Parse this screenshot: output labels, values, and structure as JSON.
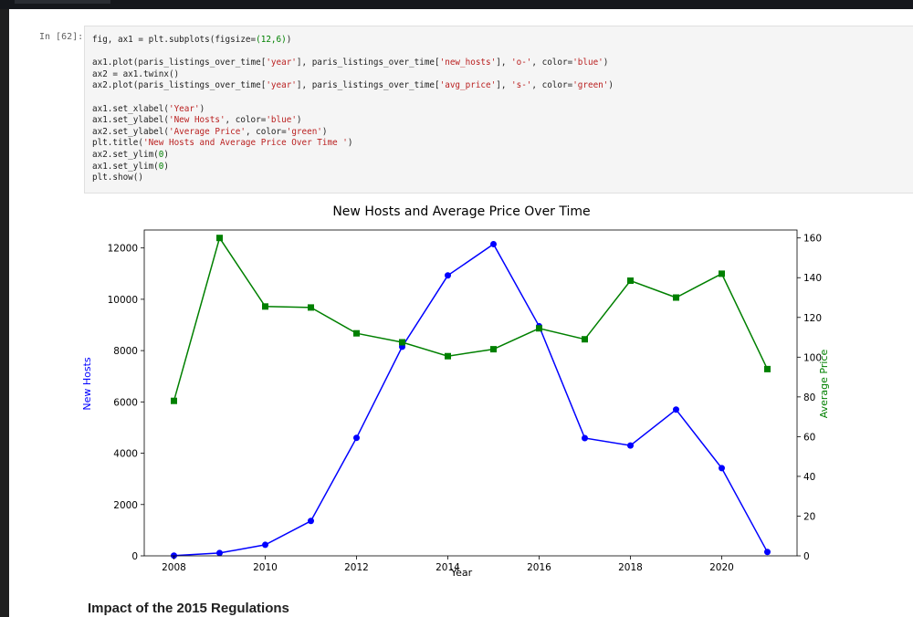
{
  "cell": {
    "prompt": "In [62]:",
    "code_lines": [
      [
        [
          "fig, ax1 = plt.subplots(figsize=",
          ""
        ],
        [
          "(12,6)",
          "n"
        ],
        [
          ")",
          ""
        ]
      ],
      [],
      [
        [
          "ax1.plot(paris_listings_over_time[",
          ""
        ],
        [
          "'year'",
          "s"
        ],
        [
          "], paris_listings_over_time[",
          ""
        ],
        [
          "'new_hosts'",
          "s"
        ],
        [
          "], ",
          ""
        ],
        [
          "'o-'",
          "s"
        ],
        [
          ", color=",
          ""
        ],
        [
          "'blue'",
          "s"
        ],
        [
          ")",
          ""
        ]
      ],
      [
        [
          "ax2 = ax1.twinx()",
          ""
        ]
      ],
      [
        [
          "ax2.plot(paris_listings_over_time[",
          ""
        ],
        [
          "'year'",
          "s"
        ],
        [
          "], paris_listings_over_time[",
          ""
        ],
        [
          "'avg_price'",
          "s"
        ],
        [
          "], ",
          ""
        ],
        [
          "'s-'",
          "s"
        ],
        [
          ", color=",
          ""
        ],
        [
          "'green'",
          "s"
        ],
        [
          ")",
          ""
        ]
      ],
      [],
      [
        [
          "ax1.set_xlabel(",
          ""
        ],
        [
          "'Year'",
          "s"
        ],
        [
          ")",
          ""
        ]
      ],
      [
        [
          "ax1.set_ylabel(",
          ""
        ],
        [
          "'New Hosts'",
          "s"
        ],
        [
          ", color=",
          ""
        ],
        [
          "'blue'",
          "s"
        ],
        [
          ")",
          ""
        ]
      ],
      [
        [
          "ax2.set_ylabel(",
          ""
        ],
        [
          "'Average Price'",
          "s"
        ],
        [
          ", color=",
          ""
        ],
        [
          "'green'",
          "s"
        ],
        [
          ")",
          ""
        ]
      ],
      [
        [
          "plt.title(",
          ""
        ],
        [
          "'New Hosts and Average Price Over Time '",
          "s"
        ],
        [
          ")",
          ""
        ]
      ],
      [
        [
          "ax2.set_ylim(",
          ""
        ],
        [
          "0",
          "n"
        ],
        [
          ")",
          ""
        ]
      ],
      [
        [
          "ax1.set_ylim(",
          ""
        ],
        [
          "0",
          "n"
        ],
        [
          ")",
          ""
        ]
      ],
      [
        [
          "plt.show()",
          ""
        ]
      ]
    ]
  },
  "chart_data": {
    "type": "line",
    "title": "New Hosts and Average Price Over Time",
    "xlabel": "Year",
    "ylabel_left": "New Hosts",
    "ylabel_right": "Average Price",
    "x": [
      2008,
      2009,
      2010,
      2011,
      2012,
      2013,
      2014,
      2015,
      2016,
      2017,
      2018,
      2019,
      2020,
      2021
    ],
    "xlim": [
      2007.35,
      2021.65
    ],
    "xticks": [
      2008,
      2010,
      2012,
      2014,
      2016,
      2018,
      2020
    ],
    "ylim_left": [
      0,
      12700
    ],
    "yticks_left": [
      0,
      2000,
      4000,
      6000,
      8000,
      10000,
      12000
    ],
    "ylim_right": [
      0,
      164
    ],
    "yticks_right": [
      0,
      20,
      40,
      60,
      80,
      100,
      120,
      140,
      160
    ],
    "grid": false,
    "series": [
      {
        "name": "new_hosts",
        "axis": "left",
        "marker": "circle",
        "color": "#0000ff",
        "values": [
          10,
          110,
          430,
          1360,
          4600,
          8150,
          10930,
          12150,
          8950,
          4590,
          4300,
          5700,
          3420,
          150
        ]
      },
      {
        "name": "avg_price",
        "axis": "right",
        "marker": "square",
        "color": "#008000",
        "values": [
          78,
          160,
          125.5,
          125,
          112,
          107.5,
          100.5,
          104,
          114.5,
          109,
          138.5,
          130,
          142,
          94
        ]
      }
    ]
  },
  "section_heading": "Impact of the 2015 Regulations"
}
